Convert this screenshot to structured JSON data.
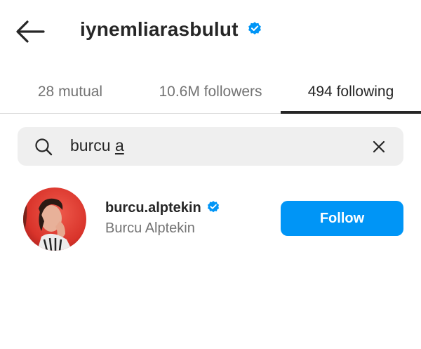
{
  "header": {
    "title": "iynemliarasbulut",
    "back_icon": "arrow-left-icon",
    "verified_icon": "verified-badge-icon"
  },
  "tabs": [
    {
      "label": "28 mutual",
      "active": false
    },
    {
      "label": "10.6M followers",
      "active": false
    },
    {
      "label": "494 following",
      "active": true
    }
  ],
  "search": {
    "value_prefix": "burcu ",
    "value_last": "a",
    "search_icon": "search-icon",
    "clear_icon": "close-icon"
  },
  "results": [
    {
      "username": "burcu.alptekin",
      "full_name": "Burcu Alptekin",
      "verified": true,
      "follow_label": "Follow"
    }
  ],
  "colors": {
    "accent": "#0095f6",
    "text": "#262626",
    "muted": "#737373",
    "search_bg": "#efefef",
    "verified": "#0095f6"
  }
}
